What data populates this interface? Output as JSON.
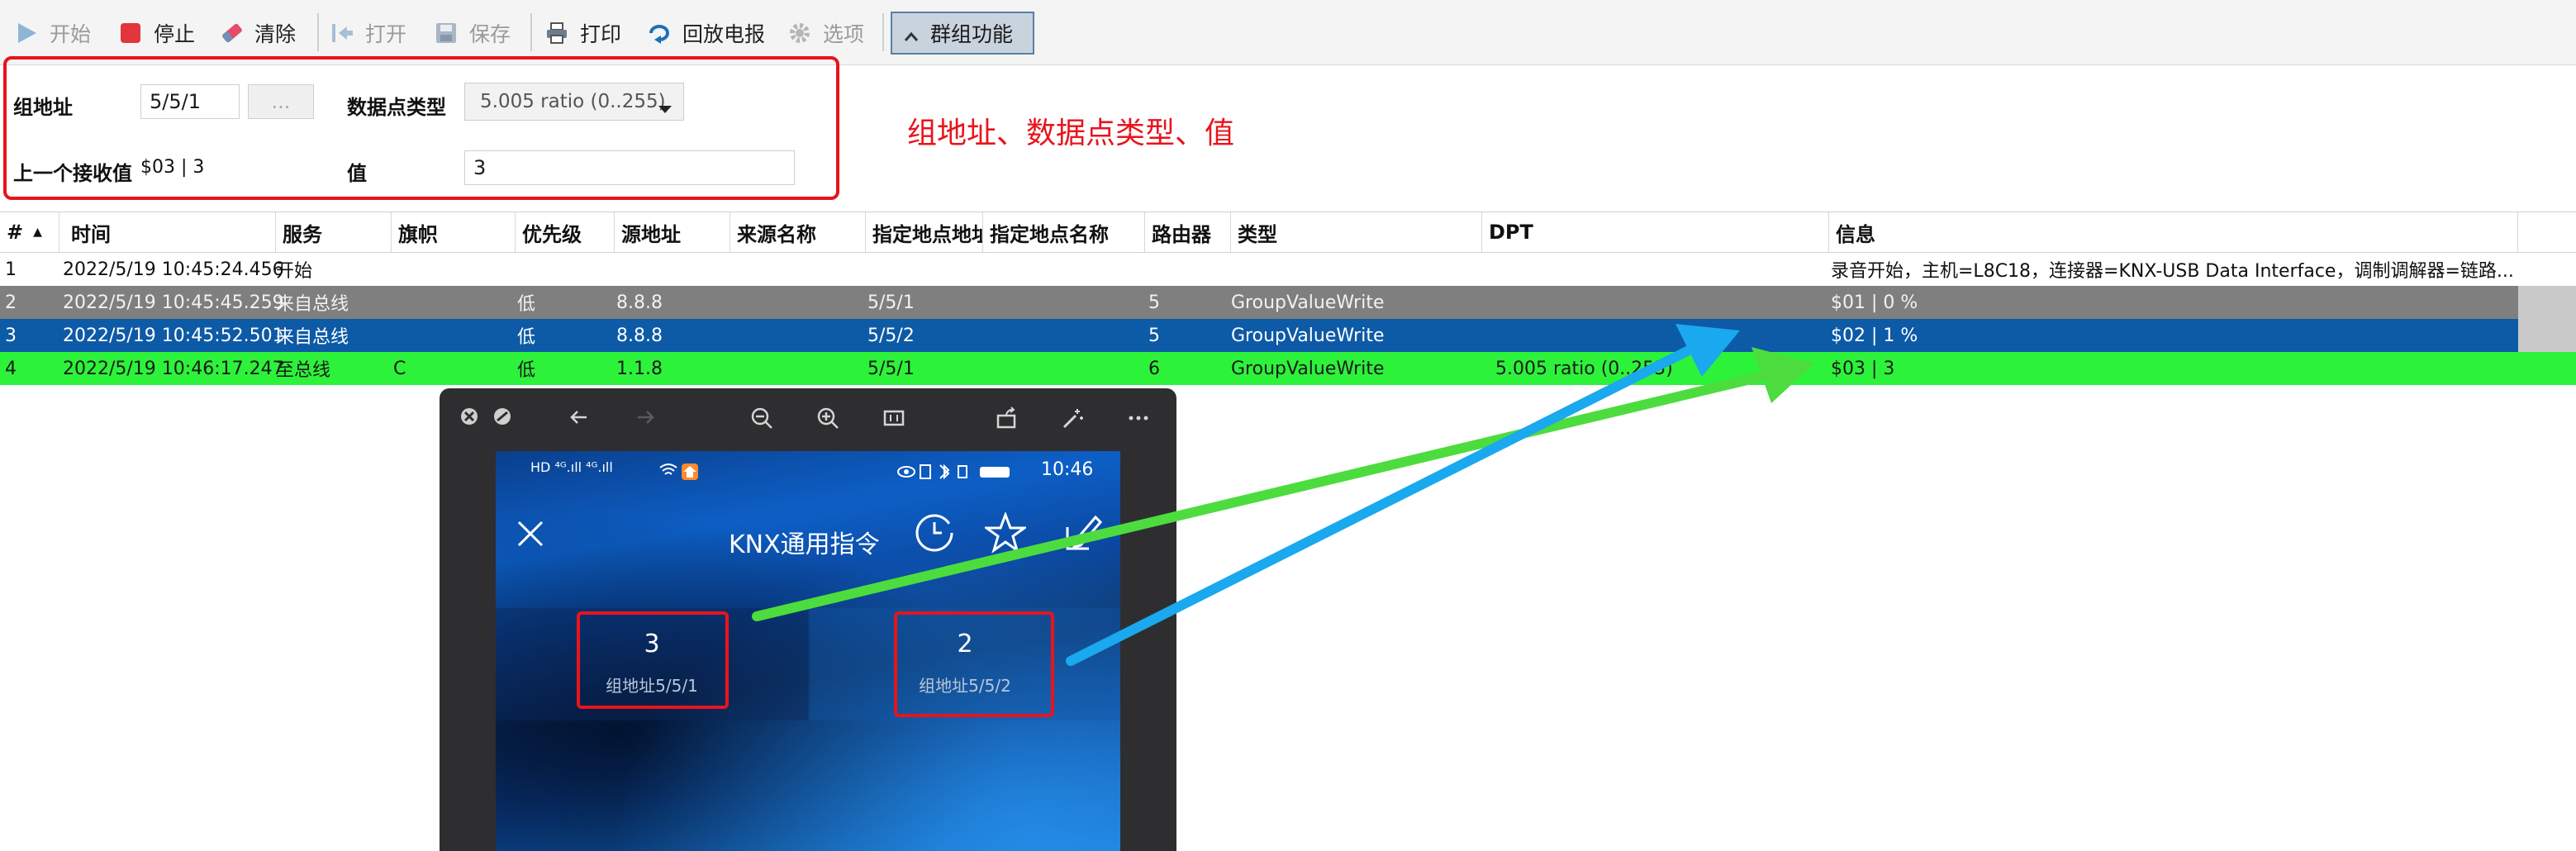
{
  "toolbar": {
    "start": "开始",
    "stop": "停止",
    "clear": "清除",
    "open": "打开",
    "save": "保存",
    "print": "打印",
    "replay": "回放电报",
    "options": "选项",
    "group": "群组功能"
  },
  "form": {
    "group_address_label": "组地址",
    "group_address_value": "5/5/1",
    "browse_button": "...",
    "dpt_label": "数据点类型",
    "dpt_value": "5.005 ratio (0..255)",
    "last_received_label": "上一个接收值",
    "last_received_value": "$03 | 3",
    "value_label": "值",
    "value_input": "3"
  },
  "annotation": "组地址、数据点类型、值",
  "table": {
    "columns": [
      "#",
      "时间",
      "服务",
      "旗帜",
      "优先级",
      "源地址",
      "来源名称",
      "指定地点地址",
      "指定地点名称",
      "路由器",
      "类型",
      "DPT",
      "信息"
    ],
    "sort_indicator": "▲",
    "rows": [
      {
        "num": "1",
        "time": "2022/5/19 10:45:24.456",
        "service": "开始",
        "flags": "",
        "priority": "",
        "source": "",
        "source_name": "",
        "dest": "",
        "dest_name": "",
        "router": "",
        "type": "",
        "dpt": "",
        "info": "录音开始，主机=L8C18，连接器=KNX-USB Data Interface，调制调解器=链路..."
      },
      {
        "num": "2",
        "time": "2022/5/19 10:45:45.259",
        "service": "来自总线",
        "flags": "",
        "priority": "低",
        "source": "8.8.8",
        "source_name": "",
        "dest": "5/5/1",
        "dest_name": "",
        "router": "5",
        "type": "GroupValueWrite",
        "dpt": "",
        "info": "$01 | 0 %"
      },
      {
        "num": "3",
        "time": "2022/5/19 10:45:52.501",
        "service": "来自总线",
        "flags": "",
        "priority": "低",
        "source": "8.8.8",
        "source_name": "",
        "dest": "5/5/2",
        "dest_name": "",
        "router": "5",
        "type": "GroupValueWrite",
        "dpt": "",
        "info": "$02 | 1 %"
      },
      {
        "num": "4",
        "time": "2022/5/19 10:46:17.247",
        "service": "至总线",
        "flags": "C",
        "priority": "低",
        "source": "1.1.8",
        "source_name": "",
        "dest": "5/5/1",
        "dest_name": "",
        "router": "6",
        "type": "GroupValueWrite",
        "dpt": "5.005 ratio (0..255)",
        "info": "$03 | 3"
      }
    ]
  },
  "phone": {
    "status_icons": "HD ⁴ᴳ.ıll ⁴ᴳ.ıll",
    "status_right": "10:46",
    "title": "KNX通用指令",
    "tiles": [
      {
        "value": "3",
        "label": "组地址5/5/1"
      },
      {
        "value": "2",
        "label": "组地址5/5/2"
      }
    ]
  },
  "colors": {
    "row2_bg": "#7f7f7f",
    "row3_bg": "#0d5aa7",
    "row4_bg": "#2df23a",
    "annotation_red": "#e8141c",
    "arrow_green": "#4ddc3e",
    "arrow_blue": "#1aa8ee"
  }
}
